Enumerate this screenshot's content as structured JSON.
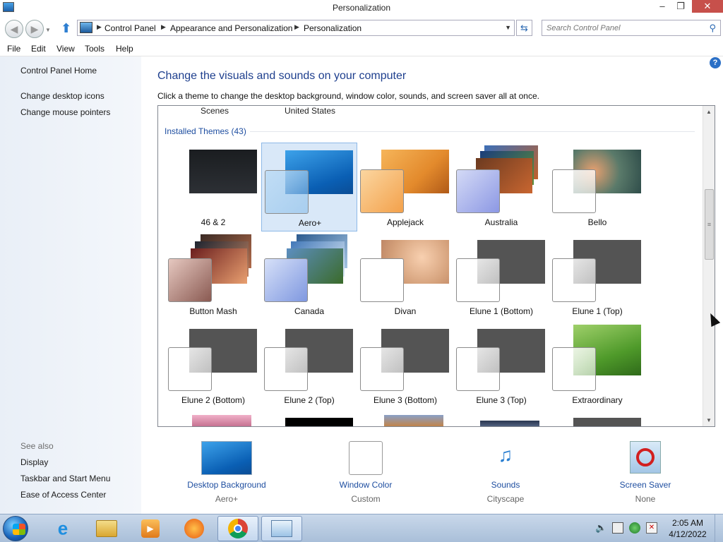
{
  "window": {
    "title": "Personalization"
  },
  "nav": {
    "breadcrumbs": [
      "Control Panel",
      "Appearance and Personalization",
      "Personalization"
    ],
    "search_placeholder": "Search Control Panel"
  },
  "menu": [
    "File",
    "Edit",
    "View",
    "Tools",
    "Help"
  ],
  "left": {
    "home": "Control Panel Home",
    "links": [
      "Change desktop icons",
      "Change mouse pointers"
    ],
    "see_also_title": "See also",
    "see_also": [
      "Display",
      "Taskbar and Start Menu",
      "Ease of Access Center"
    ]
  },
  "main": {
    "heading": "Change the visuals and sounds on your computer",
    "subheading": "Click a theme to change the desktop background, window color, sounds, and screen saver all at once.",
    "previous_row": [
      "Scenes",
      "United States"
    ],
    "group_title": "Installed Themes (43)",
    "themes": [
      "46 & 2",
      "Aero+",
      "Applejack",
      "Australia",
      "Bello",
      "Button Mash",
      "Canada",
      "Divan",
      "Elune 1 (Bottom)",
      "Elune 1 (Top)",
      "Elune 2 (Bottom)",
      "Elune 2 (Top)",
      "Elune 3 (Bottom)",
      "Elune 3 (Top)",
      "Extraordinary"
    ],
    "selected_theme": "Aero+"
  },
  "options": {
    "background": {
      "name": "Desktop Background",
      "value": "Aero+"
    },
    "color": {
      "name": "Window Color",
      "value": "Custom"
    },
    "sounds": {
      "name": "Sounds",
      "value": "Cityscape"
    },
    "saver": {
      "name": "Screen Saver",
      "value": "None"
    }
  },
  "taskbar": {
    "time": "2:05 AM",
    "date": "4/12/2022",
    "icons": [
      "internet-explorer-icon",
      "file-explorer-icon",
      "media-player-icon",
      "app-icon",
      "chrome-icon",
      "control-panel-icon"
    ]
  }
}
